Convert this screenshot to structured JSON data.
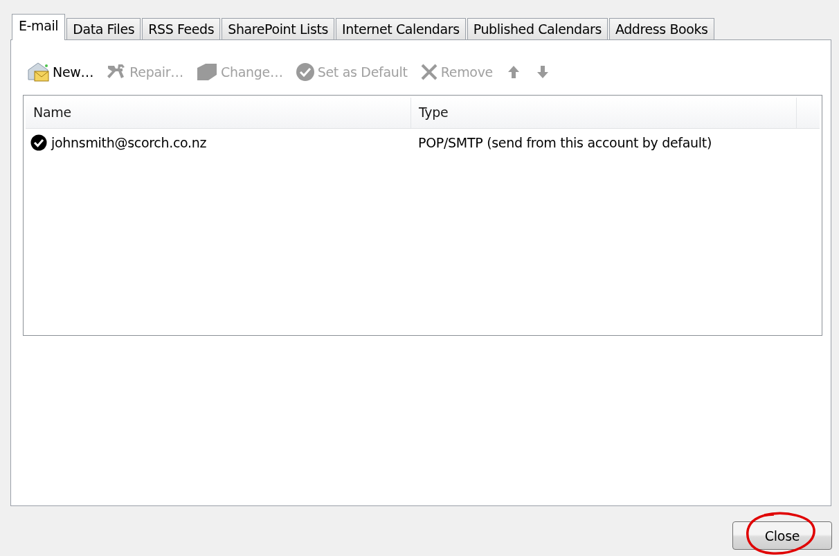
{
  "tabs": [
    {
      "label": "E-mail",
      "selected": true
    },
    {
      "label": "Data Files",
      "selected": false
    },
    {
      "label": "RSS Feeds",
      "selected": false
    },
    {
      "label": "SharePoint Lists",
      "selected": false
    },
    {
      "label": "Internet Calendars",
      "selected": false
    },
    {
      "label": "Published Calendars",
      "selected": false
    },
    {
      "label": "Address Books",
      "selected": false
    }
  ],
  "toolbar": [
    {
      "kind": "new",
      "label": "New…",
      "disabled": false
    },
    {
      "kind": "repair",
      "label": "Repair…",
      "disabled": true
    },
    {
      "kind": "change",
      "label": "Change…",
      "disabled": true
    },
    {
      "kind": "set-default",
      "label": "Set as Default",
      "disabled": true
    },
    {
      "kind": "remove",
      "label": "Remove",
      "disabled": true
    },
    {
      "kind": "move-up",
      "disabled": true
    },
    {
      "kind": "move-down",
      "disabled": true
    }
  ],
  "table": {
    "columns": [
      "Name",
      "Type"
    ],
    "rows": [
      {
        "name": "johnsmith@scorch.co.nz",
        "type": "POP/SMTP (send from this account by default)",
        "default": true
      }
    ]
  },
  "close_button": {
    "label": "Close",
    "circled": true
  }
}
